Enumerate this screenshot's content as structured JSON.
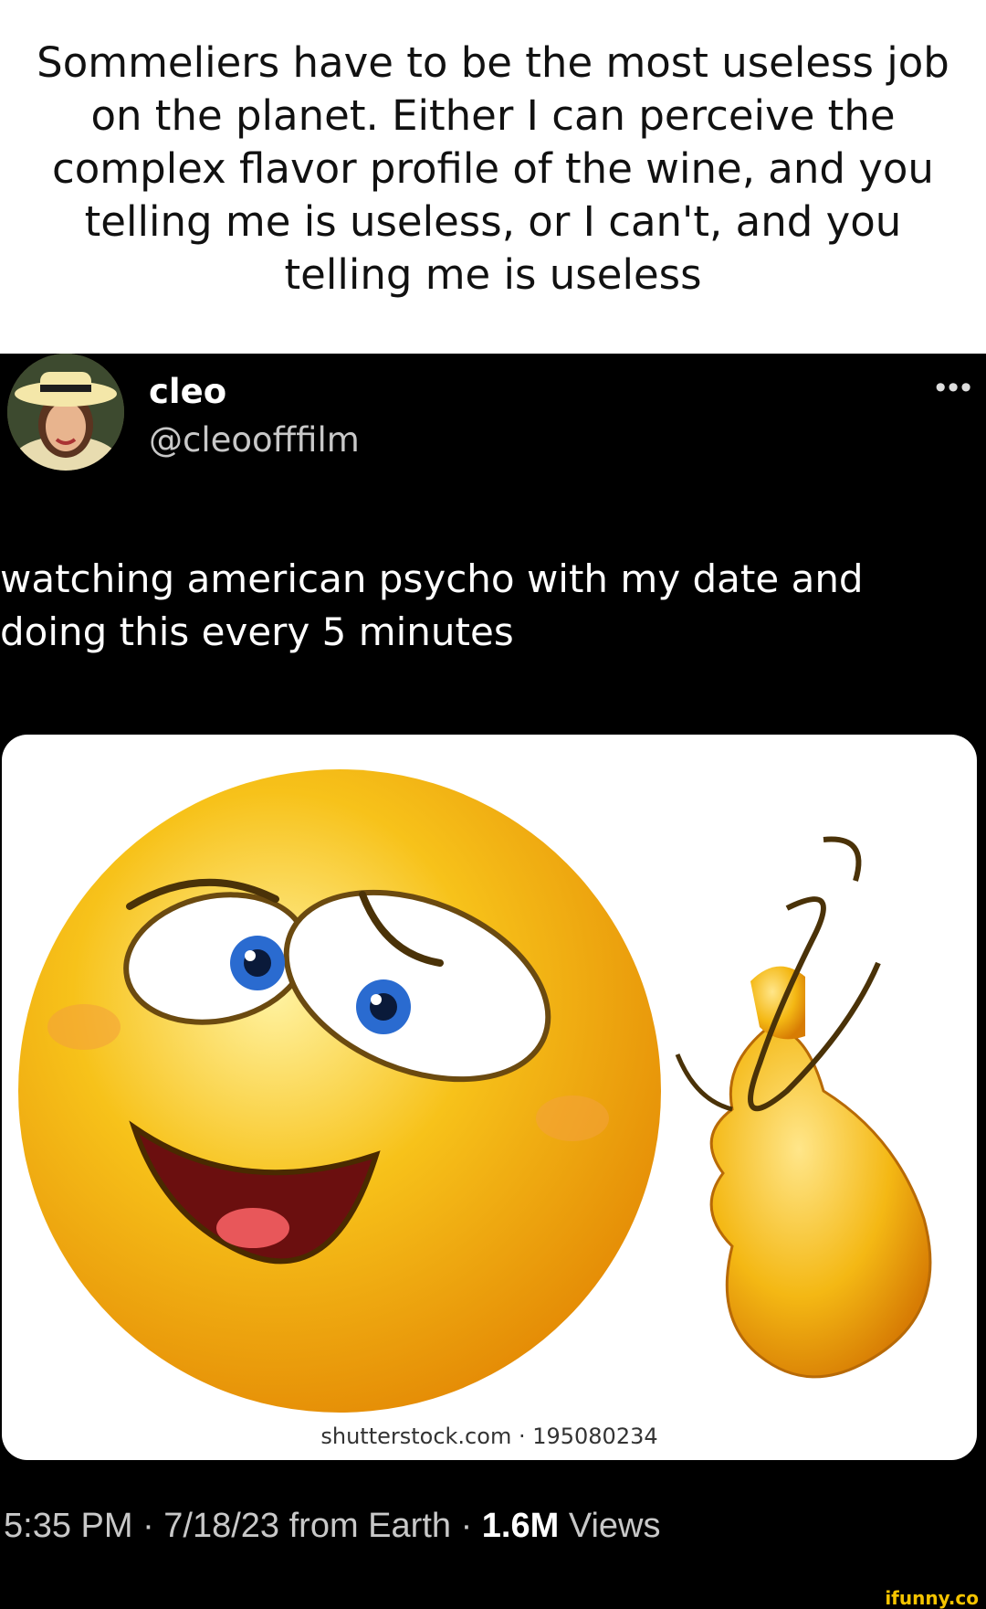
{
  "caption": "Sommeliers have to be the most useless job on the planet. Either I can perceive the complex flavor profile of the wine, and you telling me is useless, or I can't, and you telling me is useless",
  "tweet": {
    "author_name": "cleo",
    "author_handle": "@cleoofffilm",
    "more_label": "•••",
    "text": "watching american psycho with my date and doing this every 5 minutes",
    "image_watermark": "shutterstock.com · 195080234",
    "time": "5:35 PM · 7/18/23 from Earth · ",
    "views_count": "1.6M",
    "views_label": " Views"
  },
  "site_brand": "ifunny.co",
  "colors": {
    "tweet_bg": "#000000",
    "emoji_yellow": "#f7c21a",
    "brand_yellow": "#f5c400"
  },
  "icons": {
    "avatar": "avatar-photo",
    "emoji": "crazy-face-emoji"
  }
}
